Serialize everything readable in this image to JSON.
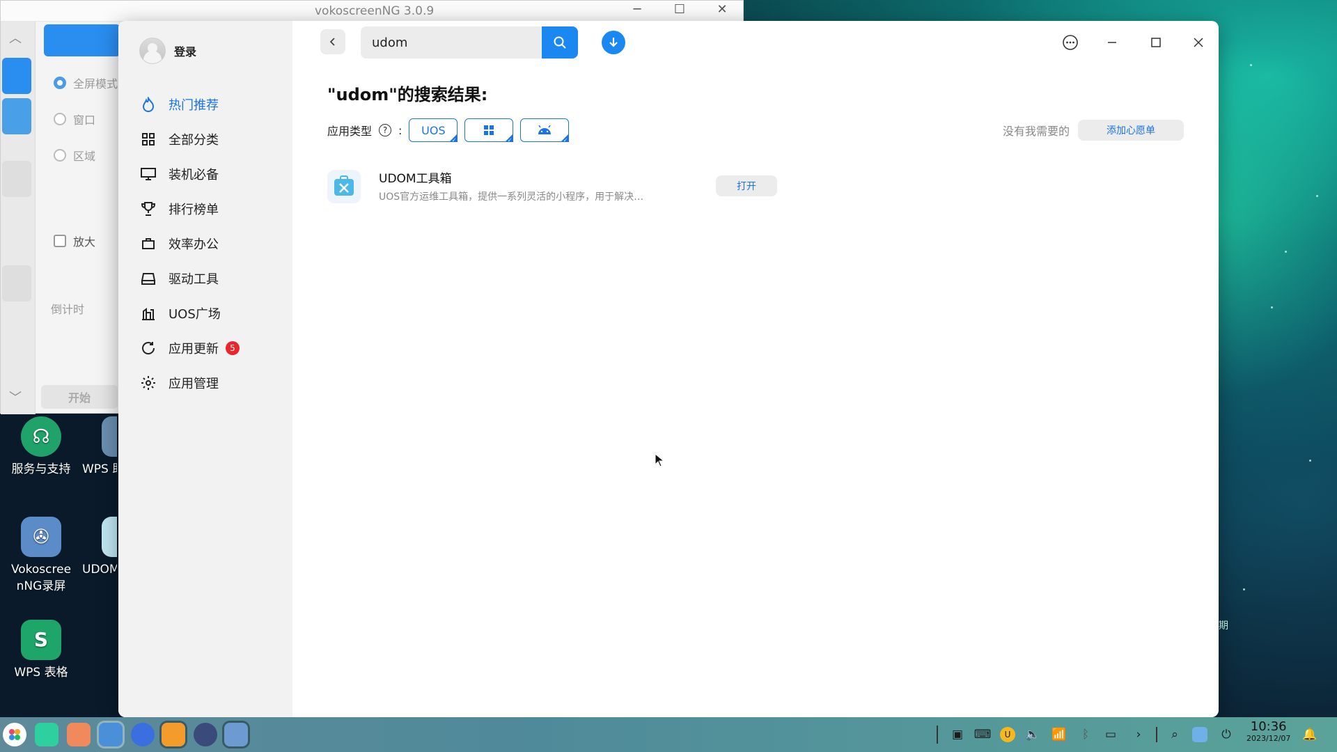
{
  "voko": {
    "title": "vokoscreenNG 3.0.9",
    "options": [
      "全屏模式",
      "窗口",
      "区域"
    ],
    "magnify": "放大",
    "countdown": "倒计时",
    "start": "开始"
  },
  "desktop": {
    "icons": [
      {
        "label": "服务与支持"
      },
      {
        "label": "WPS 助"
      },
      {
        "label": "Vokoscree nNG录屏"
      },
      {
        "label": "UDOM"
      },
      {
        "label": "WPS 表格"
      }
    ],
    "wallpaper_fragment": "期"
  },
  "store": {
    "login": "登录",
    "nav": [
      {
        "label": "热门推荐",
        "icon": "hot-icon",
        "active": true
      },
      {
        "label": "全部分类",
        "icon": "grid-icon"
      },
      {
        "label": "装机必备",
        "icon": "monitor-icon"
      },
      {
        "label": "排行榜单",
        "icon": "trophy-icon"
      },
      {
        "label": "效率办公",
        "icon": "briefcase-icon"
      },
      {
        "label": "驱动工具",
        "icon": "drive-icon"
      },
      {
        "label": "UOS广场",
        "icon": "plaza-icon"
      },
      {
        "label": "应用更新",
        "icon": "refresh-icon",
        "badge": "5"
      },
      {
        "label": "应用管理",
        "icon": "gear-icon"
      }
    ],
    "search": {
      "value": "udom"
    },
    "result_title": "\"udom\"的搜索结果:",
    "filter_label": "应用类型",
    "filter_sep": ":",
    "chips": [
      {
        "label": "UOS"
      },
      {
        "label": "windows"
      },
      {
        "label": "android"
      }
    ],
    "wish_text": "没有我需要的",
    "wish_button": "添加心愿单",
    "results": [
      {
        "name": "UDOM工具箱",
        "desc": "UOS官方运维工具箱，提供一系列灵活的小程序，用于解决…",
        "action": "打开"
      }
    ]
  },
  "taskbar": {
    "time": "10:36",
    "date": "2023/12/07"
  },
  "colors": {
    "accent": "#1a88f0",
    "active_nav": "#1a74e8",
    "badge": "#e8262b"
  }
}
